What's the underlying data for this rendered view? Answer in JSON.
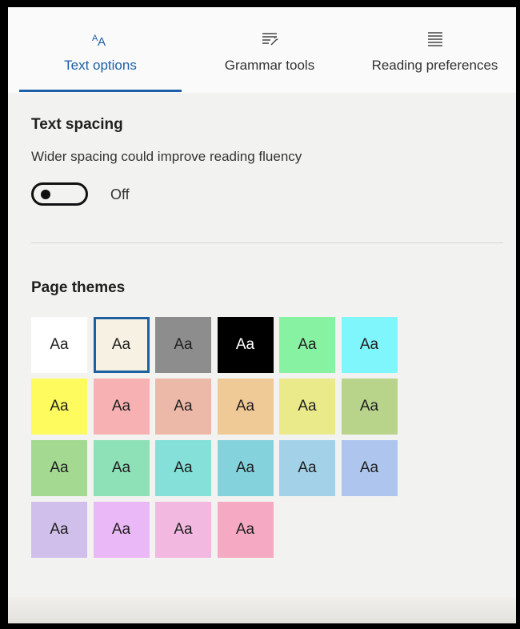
{
  "tabs": [
    {
      "label": "Text options",
      "icon": "text-size-icon",
      "active": true
    },
    {
      "label": "Grammar tools",
      "icon": "grammar-tools-icon",
      "active": false
    },
    {
      "label": "Reading preferences",
      "icon": "reading-preferences-icon",
      "active": false
    }
  ],
  "text_spacing": {
    "title": "Text spacing",
    "description": "Wider spacing could improve reading fluency",
    "toggle_state": "Off"
  },
  "page_themes": {
    "title": "Page themes",
    "sample_text": "Aa",
    "selected_index": 1,
    "swatches": [
      {
        "color": "#ffffff",
        "text_color": "#1f1f1f"
      },
      {
        "color": "#f7f1e4",
        "text_color": "#1f1f1f"
      },
      {
        "color": "#8d8d8d",
        "text_color": "#1f1f1f"
      },
      {
        "color": "#000000",
        "text_color": "#ffffff"
      },
      {
        "color": "#87f3a2",
        "text_color": "#1f1f1f"
      },
      {
        "color": "#7ff6fb",
        "text_color": "#1f1f1f"
      },
      {
        "color": "#fdfb5d",
        "text_color": "#1f1f1f"
      },
      {
        "color": "#f7b1b3",
        "text_color": "#1f1f1f"
      },
      {
        "color": "#ecb9a8",
        "text_color": "#1f1f1f"
      },
      {
        "color": "#efc996",
        "text_color": "#1f1f1f"
      },
      {
        "color": "#ebea8a",
        "text_color": "#1f1f1f"
      },
      {
        "color": "#b8d48a",
        "text_color": "#1f1f1f"
      },
      {
        "color": "#a4d992",
        "text_color": "#1f1f1f"
      },
      {
        "color": "#8ee0b7",
        "text_color": "#1f1f1f"
      },
      {
        "color": "#84e0d8",
        "text_color": "#1f1f1f"
      },
      {
        "color": "#84d3dc",
        "text_color": "#1f1f1f"
      },
      {
        "color": "#a3d1e8",
        "text_color": "#1f1f1f"
      },
      {
        "color": "#aec6ee",
        "text_color": "#1f1f1f"
      },
      {
        "color": "#d0bfea",
        "text_color": "#1f1f1f"
      },
      {
        "color": "#eab8f6",
        "text_color": "#1f1f1f"
      },
      {
        "color": "#f2b8df",
        "text_color": "#1f1f1f"
      },
      {
        "color": "#f5a9c2",
        "text_color": "#1f1f1f"
      }
    ]
  },
  "colors": {
    "accent": "#1b5fa8",
    "panel_background": "#f2f2f0",
    "tab_bar_background": "#fafafa"
  }
}
